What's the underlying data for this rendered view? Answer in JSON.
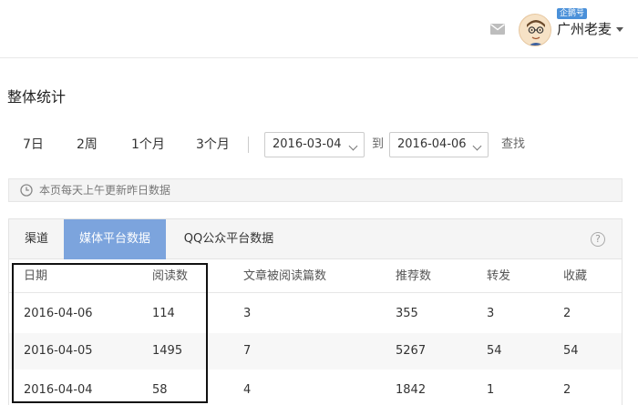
{
  "header": {
    "badge": "企鹅号",
    "username": "广州老麦"
  },
  "page_title": "整体统计",
  "filters": {
    "ranges": [
      "7日",
      "2周",
      "1个月",
      "3个月"
    ],
    "start_date": "2016-03-04",
    "to_label": "到",
    "end_date": "2016-04-06",
    "search_label": "查找"
  },
  "notice": "本页每天上午更新昨日数据",
  "tabs": [
    "渠道",
    "媒体平台数据",
    "QQ公众平台数据"
  ],
  "active_tab": 1,
  "table": {
    "columns": [
      "日期",
      "阅读数",
      "文章被阅读篇数",
      "推荐数",
      "转发",
      "收藏"
    ],
    "rows": [
      [
        "2016-04-06",
        "114",
        "3",
        "355",
        "3",
        "2"
      ],
      [
        "2016-04-05",
        "1495",
        "7",
        "5267",
        "54",
        "54"
      ],
      [
        "2016-04-04",
        "58",
        "4",
        "1842",
        "1",
        "2"
      ]
    ]
  },
  "colors": {
    "active_tab": "#7ca4dd",
    "badge": "#4a90d9"
  }
}
